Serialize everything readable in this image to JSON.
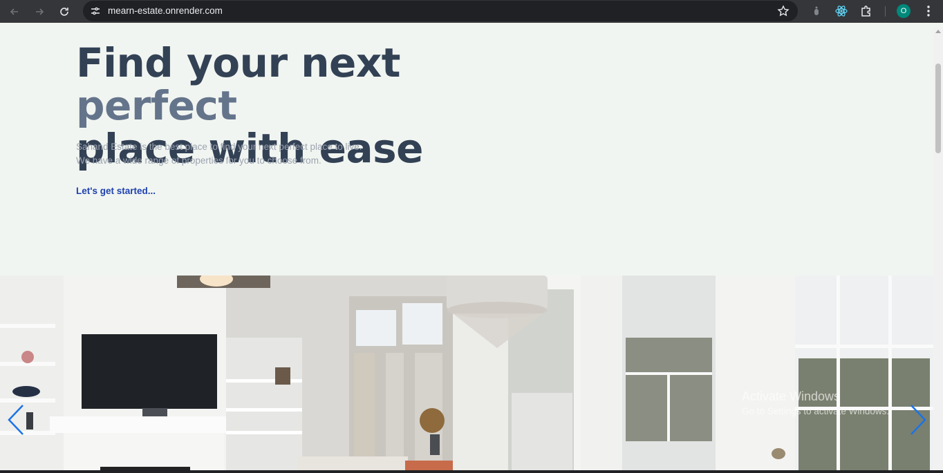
{
  "browser": {
    "url": "mearn-estate.onrender.com",
    "profile_initial": "O",
    "icons": {
      "back": "arrow-left-icon",
      "forward": "arrow-right-icon",
      "reload": "reload-icon",
      "site_info": "tune-icon",
      "bookmark": "star-icon",
      "extension_1": "extension-dot-icon",
      "extension_2": "react-icon",
      "extensions": "puzzle-icon",
      "menu": "kebab-menu-icon"
    },
    "colors": {
      "toolbar": "#35363a",
      "omnibox": "#202124",
      "avatar": "#00897b"
    }
  },
  "hero": {
    "title_part1": "Find your next ",
    "title_accent": "perfect",
    "title_part2": "place with ease",
    "description_line1": "Sahand Estate is the best place to find your next perfect place to live.",
    "description_line2": "We have a wide range of properties for you to choose from.",
    "cta": "Let's get started...",
    "colors": {
      "title": "#334155",
      "accent": "#64748b",
      "text": "#9ca3af",
      "link": "#1e40af",
      "background": "#f1f5f1"
    }
  },
  "slider": {
    "image_subject": "bright living room interior with fireplace, TV, chandelier and large windows",
    "prev_icon": "chevron-left-icon",
    "next_icon": "chevron-right-icon",
    "arrow_color": "#1a73e8"
  },
  "os_watermark": {
    "line1": "Activate Windows",
    "line2": "Go to Settings to activate Windows."
  }
}
